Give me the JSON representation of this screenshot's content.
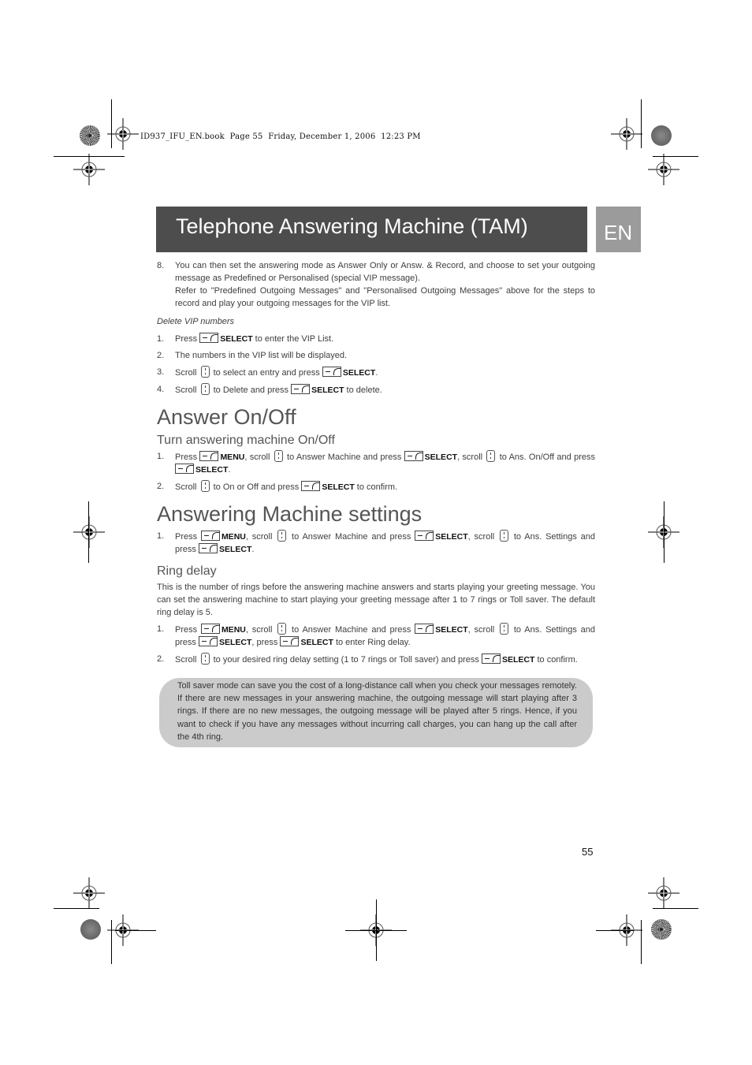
{
  "print_header": "ID937_IFU_EN.book  Page 55  Friday, December 1, 2006  12:23 PM",
  "banner": {
    "title": "Telephone Answering Machine (TAM)",
    "language_tab": "EN"
  },
  "colors": {
    "banner_bg": "#4d4d4d",
    "language_tab_bg": "#9b9b9b",
    "note_bg": "#cbcbcb",
    "heading_text": "#555555"
  },
  "intro_step": {
    "num": "8.",
    "text1": "You can then set the answering mode as Answer Only or Answ. & Record, and choose to set your outgoing message as Predefined or Personalised (special VIP message).",
    "text2": "Refer to \"Predefined Outgoing Messages\" and \"Personalised Outgoing Messages\" above for the steps to record and play your outgoing messages for the VIP list."
  },
  "delete_vip": {
    "heading": "Delete VIP numbers",
    "steps": [
      {
        "num": "1.",
        "a": "Press ",
        "key1": "SELECT",
        "b": " to enter the VIP List."
      },
      {
        "num": "2.",
        "a": "The numbers in the VIP list will be displayed."
      },
      {
        "num": "3.",
        "a": "Scroll ",
        "b": " to select an entry and press ",
        "key1": "SELECT",
        "c": "."
      },
      {
        "num": "4.",
        "a": "Scroll ",
        "b": " to Delete and press ",
        "key1": "SELECT",
        "c": " to delete."
      }
    ]
  },
  "answer_onoff": {
    "heading": "Answer On/Off",
    "subheading": "Turn answering machine On/Off",
    "steps": [
      {
        "num": "1.",
        "a": "Press ",
        "menu": "MENU",
        "b": ", scroll ",
        "c": " to Answer Machine and press ",
        "select1": "SELECT",
        "d": ", scroll ",
        "e": " to Ans. On/Off and press ",
        "select2": "SELECT",
        "f": "."
      },
      {
        "num": "2.",
        "a": "Scroll ",
        "b": " to On or Off and press ",
        "select1": "SELECT",
        "c": " to confirm."
      }
    ]
  },
  "am_settings": {
    "heading": "Answering Machine settings",
    "steps": [
      {
        "num": "1.",
        "a": "Press ",
        "menu": "MENU",
        "b": ", scroll ",
        "c": " to Answer Machine and press ",
        "select1": "SELECT",
        "d": ", scroll ",
        "e": " to Ans. Settings and press ",
        "select2": "SELECT",
        "f": "."
      }
    ]
  },
  "ring_delay": {
    "heading": "Ring delay",
    "description": "This is the number of rings before the answering machine answers and starts playing your greeting message. You can set the answering machine to start playing your greeting message after 1 to 7 rings or Toll saver. The default ring delay is 5.",
    "steps": [
      {
        "num": "1.",
        "a": "Press ",
        "menu": "MENU",
        "b": ", scroll ",
        "c": " to Answer Machine and press ",
        "select1": "SELECT",
        "d": ", scroll ",
        "e": " to Ans. Settings and press ",
        "select2": "SELECT",
        "f": ", press ",
        "select3": "SELECT",
        "g": " to enter Ring delay."
      },
      {
        "num": "2.",
        "a": "Scroll ",
        "b": " to your desired ring delay setting (1 to 7 rings or Toll saver) and press ",
        "select1": "SELECT",
        "c": " to confirm."
      }
    ],
    "note": "Toll saver mode can save you the cost of a long-distance call when you check your messages remotely. If there are new messages in your answering machine, the outgoing message will start playing after 3 rings. If there are no new messages, the outgoing message will be played after 5 rings. Hence, if you want to check if you have any messages without incurring call charges, you can hang up the call after the 4th ring."
  },
  "page_number": "55"
}
